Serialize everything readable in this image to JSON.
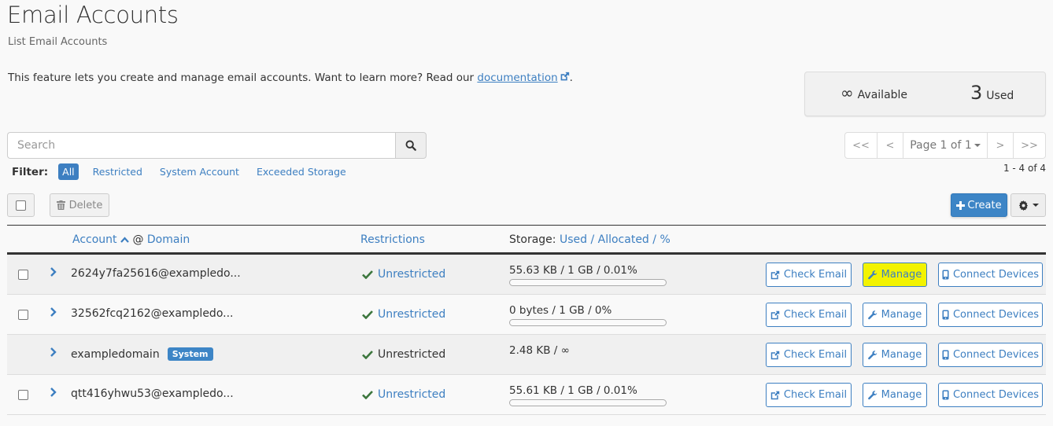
{
  "header": {
    "title": "Email Accounts",
    "subtitle": "List Email Accounts",
    "intro_text": "This feature lets you create and manage email accounts. Want to learn more? Read our ",
    "intro_link": "documentation",
    "intro_end": "."
  },
  "stats": {
    "available_value": "∞",
    "available_label": "Available",
    "used_value": "3",
    "used_label": "Used"
  },
  "search": {
    "placeholder": "Search",
    "value": ""
  },
  "filter": {
    "label": "Filter:",
    "items": [
      "All",
      "Restricted",
      "System Account",
      "Exceeded Storage"
    ],
    "active": "All"
  },
  "pagination": {
    "first": "<<",
    "prev": "<",
    "page_label": "Page 1 of 1",
    "next": ">",
    "last": ">>",
    "range": "1 - 4 of 4"
  },
  "toolbar": {
    "delete_label": "Delete",
    "create_label": "Create"
  },
  "table": {
    "columns": {
      "account": "Account",
      "at": "@",
      "domain": "Domain",
      "restrictions": "Restrictions",
      "storage_prefix": "Storage:",
      "storage_used": "Used",
      "storage_allocated": "Allocated",
      "storage_pct": "%",
      "sep": "/"
    },
    "rows": [
      {
        "account": "2624y7fa25616@exampledo...",
        "restriction": "Unrestricted",
        "storage": "55.63 KB / 1 GB / 0.01%",
        "usage_pct": 0.01,
        "system": false
      },
      {
        "account": "32562fcq2162@exampledo...",
        "restriction": "Unrestricted",
        "storage": "0 bytes / 1 GB / 0%",
        "usage_pct": 0,
        "system": false
      },
      {
        "account": "exampledomain",
        "badge": "System",
        "restriction": "Unrestricted",
        "storage": "2.48 KB / ∞",
        "system": true
      },
      {
        "account": "qtt416yhwu53@exampledo...",
        "restriction": "Unrestricted",
        "storage": "55.61 KB / 1 GB / 0.01%",
        "usage_pct": 0.01,
        "system": false
      }
    ],
    "actions": {
      "check_email": "Check Email",
      "manage": "Manage",
      "connect_devices": "Connect Devices"
    }
  },
  "colors": {
    "accent": "#3d85c6",
    "link": "#3d7fc1",
    "success": "#3c763d",
    "highlight": "#f3f300"
  }
}
